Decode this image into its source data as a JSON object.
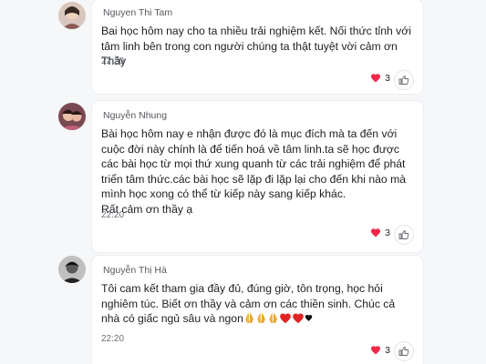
{
  "comments": [
    {
      "author": "Nguyen Thi Tam",
      "text": "Bai học hôm nay cho ta nhiều trải nghiệm kết.  Nối  thức tỉnh với tâm linh bên trong con người chúng ta  thật tuyệt vời cảm ơn Thầy",
      "time": "22:20",
      "reaction_count": "3"
    },
    {
      "author": "Nguyễn Nhung",
      "text": "Bài học hôm nay e nhận được đó là mục đích mà ta đến với cuộc đời này chính là để tiến hoá về tâm linh.ta sẽ học được các bài học từ mọi thứ xung quanh từ các trải nghiệm để phát triển tâm thức.các bài học sẽ lặp đi lặp lại cho đến khi nào mà mình học xong có thể từ kiếp này sang kiếp khác.\nRất cảm ơn thầy ạ",
      "time": "22:20",
      "reaction_count": "3"
    },
    {
      "author": "Nguyễn Thị Hà",
      "text": "Tôi cam kết tham gia đầy đủ, đúng giờ, tôn trọng, học hỏi nghiêm túc. Biết ơn thầy và cảm ơn các thiền sinh. Chúc cả nhà có giấc ngủ sâu và ngon",
      "text_emojis": [
        "folded-hands-emoji",
        "folded-hands-emoji",
        "folded-hands-emoji",
        "red-heart-emoji",
        "red-heart-emoji",
        "black-heart-emoji"
      ],
      "time": "22:20",
      "reaction_count": "3"
    }
  ],
  "colors": {
    "heart": "#f02849",
    "text": "#1c1e21",
    "muted": "#6b6f75",
    "background": "#f6f7f9"
  }
}
